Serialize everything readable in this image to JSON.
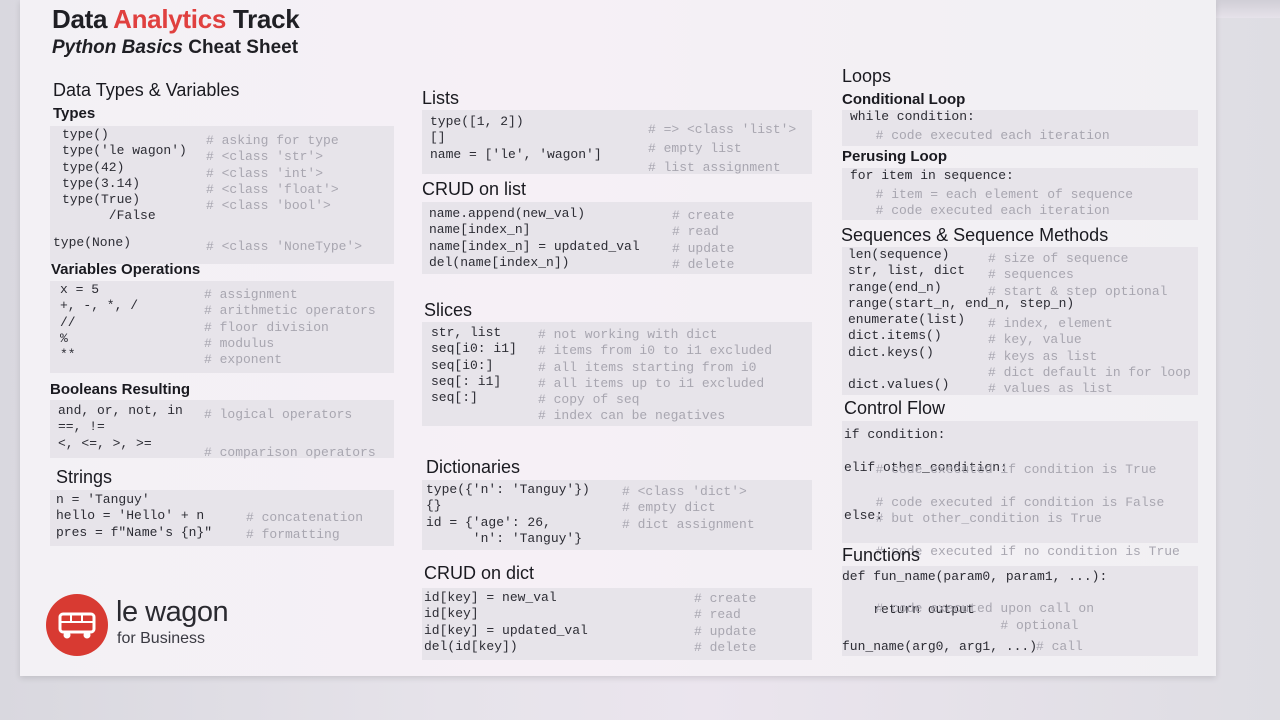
{
  "header": {
    "title_part1": "Data",
    "title_accent": "Analytics",
    "title_part2": "Track",
    "subtitle_part1": "Python Basics",
    "subtitle_part2": "Cheat Sheet"
  },
  "col1": {
    "section_title": "Data Types & Variables",
    "types_title": "Types",
    "types_code": "type()\ntype('le wagon')\ntype(42)\ntype(3.14)\ntype(True)\n      /False",
    "types_comments": "# asking for type\n# <class 'str'>\n# <class 'int'>\n# <class 'float'>\n# <class 'bool'>",
    "none_code": "type(None)",
    "none_comment": "# <class 'NoneType'>",
    "varops_title": "Variables Operations",
    "varops_code": "x = 5\n+, -, *, /\n//\n%\n**",
    "varops_comments": "# assignment\n# arithmetic operators\n# floor division\n# modulus\n# exponent",
    "bool_title": "Booleans Resulting",
    "bool_code": "and, or, not, in\n==, !=\n<, <=, >, >=",
    "bool_comments": "# logical operators\n\n# comparison operators",
    "strings_title": "Strings",
    "strings_code": "n = 'Tanguy'\nhello = 'Hello' + n\npres = f\"Name's {n}\"",
    "strings_comments": "\n# concatenation\n# formatting"
  },
  "col2": {
    "lists_title": "Lists",
    "lists_code": "type([1, 2])\n[]\nname = ['le', 'wagon']",
    "lists_comments": "# => <class 'list'>\n# empty list\n# list assignment",
    "crudlist_title": "CRUD on list",
    "crudlist_code": "name.append(new_val)\nname[index_n]\nname[index_n] = updated_val\ndel(name[index_n])",
    "crudlist_comments": "# create\n# read\n# update\n# delete",
    "slices_title": "Slices",
    "slices_code": "str, list\nseq[i0: i1]\nseq[i0:]\nseq[: i1]\nseq[:]",
    "slices_comments": "# not working with dict\n# items from i0 to i1 excluded\n# all items starting from i0\n# all items up to i1 excluded\n# copy of seq\n# index can be negatives",
    "dict_title": "Dictionaries",
    "dict_code": "type({'n': 'Tanguy'})\n{}\nid = {'age': 26,\n      'n': 'Tanguy'}",
    "dict_comments": "# <class 'dict'>\n# empty dict\n# dict assignment",
    "cruddict_title": "CRUD on dict",
    "cruddict_code": "id[key] = new_val\nid[key]\nid[key] = updated_val\ndel(id[key])",
    "cruddict_comments": "# create\n# read\n# update\n# delete"
  },
  "col3": {
    "loops_title": "Loops",
    "cond_title": "Conditional Loop",
    "cond_code": "while condition:",
    "cond_comments": "  # code executed each iteration",
    "perusing_title": "Perusing Loop",
    "perusing_code": "for item in sequence:",
    "perusing_comments": "  # item = each element of sequence\n  # code executed each iteration",
    "seq_title": "Sequences & Sequence Methods",
    "seq_code": "len(sequence)\nstr, list, dict\nrange(end_n)\nrange(start_n, end_n, step_n)\nenumerate(list)\ndict.items()\ndict.keys()\n\ndict.values()",
    "seq_comments": "# size of sequence\n# sequences\n# start & step optional\n\n# index, element\n# key, value\n# keys as list\n# dict default in for loop\n# values as list",
    "control_title": "Control Flow",
    "control_code": "if condition:\n\nelif other_condition:\n\n\nelse:",
    "control_comments": "\n  # code executed if condition is True\n\n  # code executed if condition is False\n  # but other_condition is True\n\n  # code executed if no condition is True",
    "func_title": "Functions",
    "func_code": "def fun_name(param0, param1, ...):\n\n    return output",
    "func_comments": "\n  # code executed upon call on\n                  # optional",
    "func_call": "fun_name(arg0, arg1, ...)",
    "func_call_comment": "# call"
  },
  "logo": {
    "name": "le wagon",
    "sub": "for Business",
    "icon": "bus-icon"
  }
}
